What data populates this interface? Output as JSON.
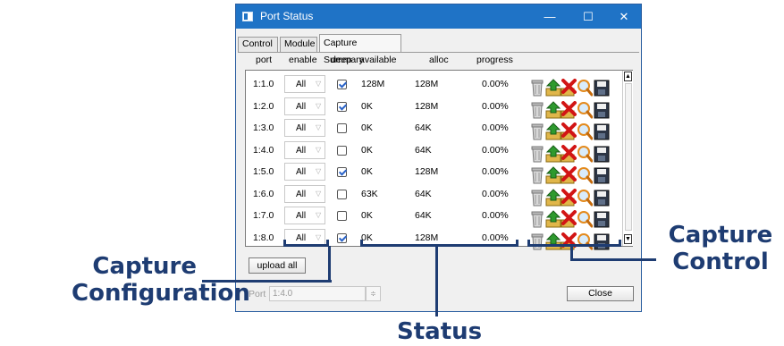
{
  "window": {
    "title": "Port Status",
    "controls": {
      "minimize": "—",
      "maximize": "☐",
      "close": "✕"
    }
  },
  "tabs": [
    {
      "label": "Control",
      "active": false
    },
    {
      "label": "Module",
      "active": false
    },
    {
      "label": "Capture Summary",
      "active": true
    }
  ],
  "columns": [
    "port",
    "enable",
    "deep",
    "available",
    "alloc",
    "progress"
  ],
  "rows": [
    {
      "port": "1:1.0",
      "enable": "All",
      "deep": true,
      "available": "128M",
      "alloc": "128M",
      "progress": "0.00%"
    },
    {
      "port": "1:2.0",
      "enable": "All",
      "deep": true,
      "available": "0K",
      "alloc": "128M",
      "progress": "0.00%"
    },
    {
      "port": "1:3.0",
      "enable": "All",
      "deep": false,
      "available": "0K",
      "alloc": "64K",
      "progress": "0.00%"
    },
    {
      "port": "1:4.0",
      "enable": "All",
      "deep": false,
      "available": "0K",
      "alloc": "64K",
      "progress": "0.00%"
    },
    {
      "port": "1:5.0",
      "enable": "All",
      "deep": true,
      "available": "0K",
      "alloc": "128M",
      "progress": "0.00%"
    },
    {
      "port": "1:6.0",
      "enable": "All",
      "deep": false,
      "available": "63K",
      "alloc": "64K",
      "progress": "0.00%"
    },
    {
      "port": "1:7.0",
      "enable": "All",
      "deep": false,
      "available": "0K",
      "alloc": "64K",
      "progress": "0.00%"
    },
    {
      "port": "1:8.0",
      "enable": "All",
      "deep": true,
      "available": "0K",
      "alloc": "128M",
      "progress": "0.00%"
    }
  ],
  "row_icons": [
    "trash-icon",
    "upload-icon",
    "delete-x-icon",
    "magnifier-icon",
    "floppy-save-icon"
  ],
  "buttons": {
    "upload_all": "upload all",
    "close": "Close"
  },
  "port_selector": {
    "label": "Port",
    "value": "1:4.0"
  },
  "callouts": {
    "capture_configuration": [
      "Capture",
      "Configuration"
    ],
    "status": "Status",
    "capture_control": [
      "Capture",
      "Control"
    ]
  },
  "colors": {
    "titlebar": "#1f73c6",
    "callout": "#1e3c72"
  }
}
